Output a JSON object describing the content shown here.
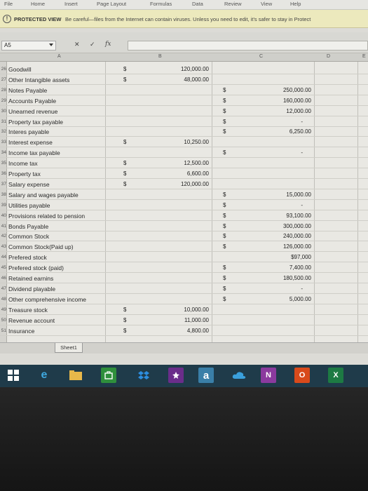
{
  "ribbon": {
    "tabs": [
      "File",
      "Home",
      "Insert",
      "Page Layout",
      "Formulas",
      "Data",
      "Review",
      "View",
      "Help"
    ]
  },
  "protected_view": {
    "title": "PROTECTED VIEW",
    "message": "Be careful—files from the Internet can contain viruses. Unless you need to edit, it's safer to stay in Protect"
  },
  "formula_bar": {
    "name_box": "A5",
    "cancel_icon": "✕",
    "enter_icon": "✓",
    "fx": "fx",
    "formula": ""
  },
  "columns": [
    "A",
    "B",
    "C",
    "D",
    "E"
  ],
  "rows": [
    {
      "num": "26",
      "label": "Goodwill",
      "d1": "$",
      "b": "120,000.00",
      "d2": "",
      "c": ""
    },
    {
      "num": "27",
      "label": "Other Intangible assets",
      "d1": "$",
      "b": "48,000.00",
      "d2": "",
      "c": ""
    },
    {
      "num": "28",
      "label": "Notes Payable",
      "d1": "",
      "b": "",
      "d2": "$",
      "c": "250,000.00"
    },
    {
      "num": "29",
      "label": "Accounts Payable",
      "d1": "",
      "b": "",
      "d2": "$",
      "c": "160,000.00"
    },
    {
      "num": "30",
      "label": "Unearned revenue",
      "d1": "",
      "b": "",
      "d2": "$",
      "c": "12,000.00"
    },
    {
      "num": "31",
      "label": "Property tax payable",
      "d1": "",
      "b": "",
      "d2": "$",
      "c": "-"
    },
    {
      "num": "32",
      "label": "Interes payable",
      "d1": "",
      "b": "",
      "d2": "$",
      "c": "6,250.00"
    },
    {
      "num": "33",
      "label": "Interest expense",
      "d1": "$",
      "b": "10,250.00",
      "d2": "",
      "c": ""
    },
    {
      "num": "34",
      "label": "Income tax payable",
      "d1": "",
      "b": "",
      "d2": "$",
      "c": "-"
    },
    {
      "num": "35",
      "label": "Income tax",
      "d1": "$",
      "b": "12,500.00",
      "d2": "",
      "c": ""
    },
    {
      "num": "36",
      "label": "Property tax",
      "d1": "$",
      "b": "6,600.00",
      "d2": "",
      "c": ""
    },
    {
      "num": "37",
      "label": "Salary expense",
      "d1": "$",
      "b": "120,000.00",
      "d2": "",
      "c": ""
    },
    {
      "num": "38",
      "label": "Salary and wages payable",
      "d1": "",
      "b": "",
      "d2": "$",
      "c": "15,000.00"
    },
    {
      "num": "39",
      "label": "Utilities payable",
      "d1": "",
      "b": "",
      "d2": "$",
      "c": "-"
    },
    {
      "num": "40",
      "label": "Provisions related to pension",
      "d1": "",
      "b": "",
      "d2": "$",
      "c": "93,100.00"
    },
    {
      "num": "41",
      "label": "Bonds Payable",
      "d1": "",
      "b": "",
      "d2": "$",
      "c": "300,000.00"
    },
    {
      "num": "42",
      "label": "Common Stock",
      "d1": "",
      "b": "",
      "d2": "$",
      "c": "240,000.00"
    },
    {
      "num": "43",
      "label": "Common Stock(Paid up)",
      "d1": "",
      "b": "",
      "d2": "$",
      "c": "126,000.00"
    },
    {
      "num": "44",
      "label": "Prefered stock",
      "d1": "",
      "b": "",
      "d2": "",
      "c": "$97,000"
    },
    {
      "num": "45",
      "label": "Prefered stock (paid)",
      "d1": "",
      "b": "",
      "d2": "$",
      "c": "7,400.00"
    },
    {
      "num": "46",
      "label": "Retained earnins",
      "d1": "",
      "b": "",
      "d2": "$",
      "c": "180,500.00"
    },
    {
      "num": "47",
      "label": "Dividend playable",
      "d1": "",
      "b": "",
      "d2": "$",
      "c": "-"
    },
    {
      "num": "48",
      "label": "Other comprehensive income",
      "d1": "",
      "b": "",
      "d2": "$",
      "c": "5,000.00"
    },
    {
      "num": "49",
      "label": "Treasure stock",
      "d1": "$",
      "b": "10,000.00",
      "d2": "",
      "c": ""
    },
    {
      "num": "50",
      "label": "Revenue account",
      "d1": "$",
      "b": "11,000.00",
      "d2": "",
      "c": ""
    },
    {
      "num": "51",
      "label": "Insurance",
      "d1": "$",
      "b": "4,800.00",
      "d2": "",
      "c": ""
    }
  ],
  "sheet_tab": "Sheet1",
  "taskbar": {
    "icons": [
      "windows-icon",
      "ie-icon",
      "store-icon",
      "dropbox-icon",
      "photos-icon",
      "amazon-icon",
      "onedrive-icon",
      "onenote-icon",
      "office-icon",
      "excel-icon"
    ],
    "amazon_label": "a",
    "onenote_label": "N",
    "office_label": "O",
    "excel_label": "X"
  },
  "colors": {
    "taskbar": "#1f3b4a",
    "protected_bar": "#ece9bd"
  }
}
